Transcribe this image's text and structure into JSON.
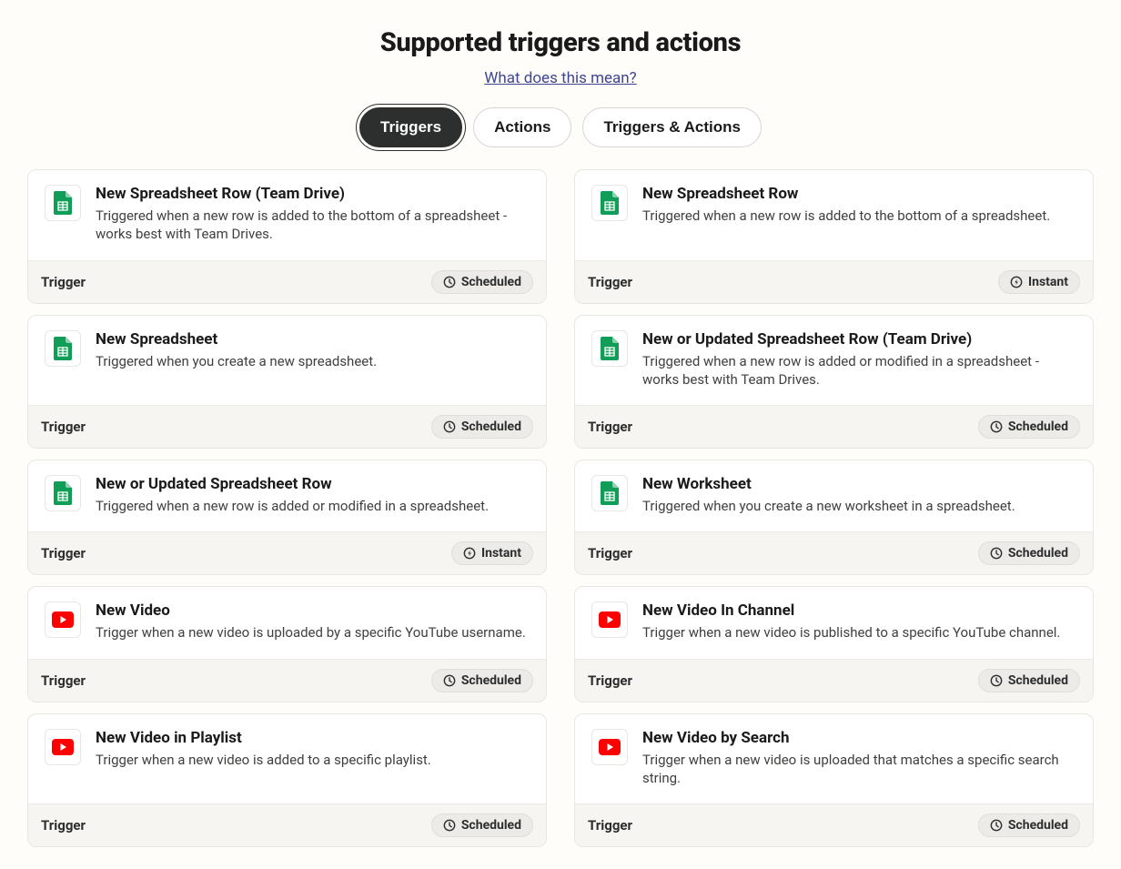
{
  "header": {
    "title": "Supported triggers and actions",
    "subtitle_link": "What does this mean?"
  },
  "tabs": [
    {
      "label": "Triggers",
      "active": true
    },
    {
      "label": "Actions",
      "active": false
    },
    {
      "label": "Triggers & Actions",
      "active": false
    }
  ],
  "footer_type_label": "Trigger",
  "badge_labels": {
    "scheduled": "Scheduled",
    "instant": "Instant"
  },
  "cards": [
    {
      "icon": "sheets",
      "title": "New Spreadsheet Row (Team Drive)",
      "desc": "Triggered when a new row is added to the bottom of a spreadsheet - works best with Team Drives.",
      "badge": "scheduled"
    },
    {
      "icon": "sheets",
      "title": "New Spreadsheet Row",
      "desc": "Triggered when a new row is added to the bottom of a spreadsheet.",
      "badge": "instant"
    },
    {
      "icon": "sheets",
      "title": "New Spreadsheet",
      "desc": "Triggered when you create a new spreadsheet.",
      "badge": "scheduled"
    },
    {
      "icon": "sheets",
      "title": "New or Updated Spreadsheet Row (Team Drive)",
      "desc": "Triggered when a new row is added or modified in a spreadsheet - works best with Team Drives.",
      "badge": "scheduled"
    },
    {
      "icon": "sheets",
      "title": "New or Updated Spreadsheet Row",
      "desc": "Triggered when a new row is added or modified in a spreadsheet.",
      "badge": "instant"
    },
    {
      "icon": "sheets",
      "title": "New Worksheet",
      "desc": "Triggered when you create a new worksheet in a spreadsheet.",
      "badge": "scheduled"
    },
    {
      "icon": "youtube",
      "title": "New Video",
      "desc": "Trigger when a new video is uploaded by a specific YouTube username.",
      "badge": "scheduled"
    },
    {
      "icon": "youtube",
      "title": "New Video In Channel",
      "desc": "Trigger when a new video is published to a specific YouTube channel.",
      "badge": "scheduled"
    },
    {
      "icon": "youtube",
      "title": "New Video in Playlist",
      "desc": "Trigger when a new video is added to a specific playlist.",
      "badge": "scheduled"
    },
    {
      "icon": "youtube",
      "title": "New Video by Search",
      "desc": "Trigger when a new video is uploaded that matches a specific search string.",
      "badge": "scheduled"
    }
  ]
}
